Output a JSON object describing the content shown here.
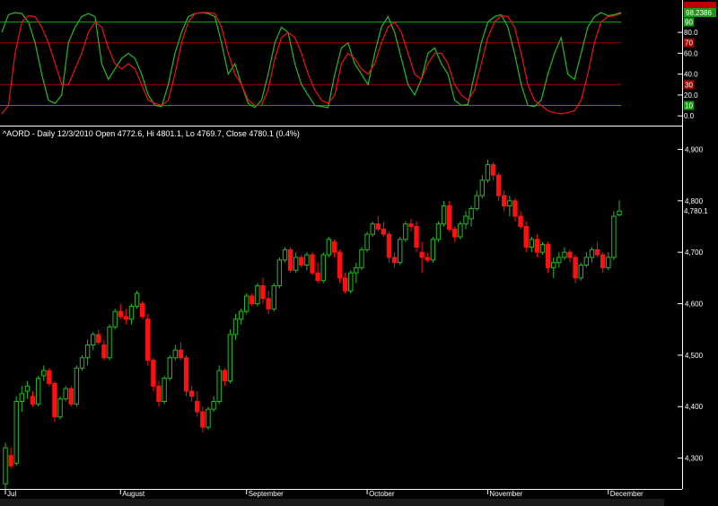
{
  "title": "^AORD - Daily 12/3/2010 Open 4772.6, Hi 4801.1, Lo 4769.7, Close 4780.1 (0.4%)",
  "colors": {
    "up": "#22bb22",
    "down": "#ff1010",
    "osc_green": "#22bb22",
    "osc_red": "#ee1111",
    "level90": "#139a13",
    "level70": "#a00000",
    "level30": "#a00000",
    "level10": "#139a13",
    "axis": "#ffffff",
    "bg": "#000000"
  },
  "chart_data": [
    {
      "type": "line",
      "name": "stochastic-oscillator",
      "ylim": [
        -5,
        105
      ],
      "y_ticks": [
        "20.0",
        "40.0",
        "60.0",
        "80.0",
        "0.0"
      ],
      "y_tick_values": [
        20,
        40,
        60,
        80,
        0
      ],
      "levels": [
        {
          "value": 90,
          "label": "90",
          "color": "#139a13"
        },
        {
          "value": 70,
          "label": "70",
          "color": "#a00000"
        },
        {
          "value": 30,
          "label": "30",
          "color": "#a00000"
        },
        {
          "value": 10,
          "label": "10",
          "color": "#139a13"
        }
      ],
      "last_value_label": "98.2386",
      "series": [
        {
          "color": "#22bb22",
          "values": [
            80,
            97,
            99,
            98,
            90,
            70,
            40,
            15,
            12,
            20,
            70,
            85,
            95,
            98,
            95,
            50,
            35,
            45,
            55,
            60,
            55,
            40,
            20,
            10,
            9,
            30,
            60,
            80,
            95,
            98,
            99,
            98,
            95,
            70,
            40,
            50,
            30,
            12,
            8,
            15,
            40,
            70,
            85,
            80,
            50,
            30,
            20,
            10,
            9,
            8,
            40,
            65,
            70,
            50,
            40,
            30,
            60,
            85,
            95,
            80,
            55,
            30,
            20,
            35,
            60,
            65,
            50,
            40,
            15,
            10,
            11,
            40,
            70,
            90,
            95,
            97,
            85,
            60,
            30,
            10,
            9,
            15,
            40,
            60,
            75,
            40,
            35,
            60,
            85,
            95,
            99,
            96,
            97,
            99
          ]
        },
        {
          "color": "#ee1111",
          "values": [
            2,
            10,
            60,
            90,
            96,
            95,
            85,
            70,
            50,
            30,
            30,
            45,
            60,
            80,
            90,
            85,
            65,
            50,
            45,
            50,
            45,
            30,
            15,
            12,
            10,
            15,
            40,
            70,
            90,
            98,
            99,
            99,
            98,
            85,
            60,
            40,
            30,
            15,
            10,
            10,
            25,
            55,
            75,
            80,
            75,
            60,
            40,
            25,
            15,
            12,
            20,
            50,
            60,
            55,
            45,
            40,
            50,
            70,
            85,
            90,
            80,
            60,
            40,
            35,
            50,
            60,
            60,
            50,
            30,
            20,
            15,
            25,
            50,
            75,
            90,
            96,
            95,
            85,
            60,
            30,
            15,
            10,
            5,
            3,
            2,
            3,
            5,
            15,
            40,
            70,
            90,
            95,
            96,
            98
          ]
        }
      ]
    },
    {
      "type": "candlestick",
      "name": "price",
      "ylim": [
        4240,
        4920
      ],
      "y_ticks": [
        "4,300",
        "4,400",
        "4,500",
        "4,600",
        "4,700",
        "4,800",
        "4,900"
      ],
      "y_tick_values": [
        4300,
        4400,
        4500,
        4600,
        4700,
        4800,
        4900
      ],
      "last_close_label": "4,780.1",
      "last_close_value": 4780.1,
      "x_labels": [
        "Jul",
        "August",
        "September",
        "October",
        "November",
        "December"
      ],
      "x_label_index": [
        0,
        21,
        44,
        66,
        88,
        110
      ],
      "ohlc": [
        [
          4250,
          4330,
          4240,
          4320
        ],
        [
          4305,
          4320,
          4280,
          4285
        ],
        [
          4290,
          4420,
          4285,
          4410
        ],
        [
          4410,
          4440,
          4390,
          4425
        ],
        [
          4430,
          4450,
          4415,
          4440
        ],
        [
          4420,
          4430,
          4400,
          4405
        ],
        [
          4405,
          4460,
          4400,
          4455
        ],
        [
          4460,
          4480,
          4450,
          4470
        ],
        [
          4470,
          4475,
          4440,
          4445
        ],
        [
          4445,
          4450,
          4370,
          4380
        ],
        [
          4380,
          4420,
          4375,
          4415
        ],
        [
          4415,
          4440,
          4410,
          4435
        ],
        [
          4435,
          4440,
          4400,
          4405
        ],
        [
          4405,
          4480,
          4400,
          4475
        ],
        [
          4475,
          4500,
          4470,
          4495
        ],
        [
          4495,
          4530,
          4480,
          4520
        ],
        [
          4520,
          4545,
          4510,
          4540
        ],
        [
          4540,
          4550,
          4520,
          4525
        ],
        [
          4520,
          4530,
          4490,
          4495
        ],
        [
          4495,
          4560,
          4490,
          4555
        ],
        [
          4555,
          4590,
          4550,
          4585
        ],
        [
          4585,
          4600,
          4570,
          4575
        ],
        [
          4575,
          4590,
          4560,
          4570
        ],
        [
          4570,
          4600,
          4560,
          4595
        ],
        [
          4595,
          4625,
          4590,
          4620
        ],
        [
          4600,
          4605,
          4570,
          4575
        ],
        [
          4570,
          4580,
          4480,
          4490
        ],
        [
          4490,
          4495,
          4430,
          4440
        ],
        [
          4440,
          4450,
          4400,
          4410
        ],
        [
          4410,
          4460,
          4405,
          4455
        ],
        [
          4455,
          4500,
          4450,
          4495
        ],
        [
          4495,
          4520,
          4490,
          4510
        ],
        [
          4510,
          4525,
          4490,
          4495
        ],
        [
          4495,
          4500,
          4420,
          4430
        ],
        [
          4430,
          4440,
          4410,
          4420
        ],
        [
          4410,
          4430,
          4380,
          4390
        ],
        [
          4390,
          4400,
          4350,
          4360
        ],
        [
          4360,
          4400,
          4355,
          4395
        ],
        [
          4395,
          4420,
          4390,
          4410
        ],
        [
          4410,
          4480,
          4405,
          4470
        ],
        [
          4470,
          4475,
          4440,
          4450
        ],
        [
          4450,
          4550,
          4445,
          4540
        ],
        [
          4540,
          4580,
          4530,
          4570
        ],
        [
          4570,
          4590,
          4560,
          4585
        ],
        [
          4585,
          4620,
          4580,
          4615
        ],
        [
          4615,
          4620,
          4595,
          4600
        ],
        [
          4600,
          4640,
          4595,
          4635
        ],
        [
          4635,
          4650,
          4600,
          4610
        ],
        [
          4610,
          4625,
          4580,
          4590
        ],
        [
          4590,
          4640,
          4585,
          4635
        ],
        [
          4635,
          4690,
          4630,
          4685
        ],
        [
          4685,
          4710,
          4680,
          4705
        ],
        [
          4705,
          4710,
          4660,
          4665
        ],
        [
          4665,
          4700,
          4660,
          4690
        ],
        [
          4690,
          4695,
          4670,
          4675
        ],
        [
          4675,
          4700,
          4665,
          4695
        ],
        [
          4695,
          4700,
          4655,
          4660
        ],
        [
          4660,
          4680,
          4640,
          4645
        ],
        [
          4645,
          4700,
          4640,
          4695
        ],
        [
          4695,
          4730,
          4690,
          4725
        ],
        [
          4720,
          4725,
          4690,
          4700
        ],
        [
          4700,
          4705,
          4640,
          4650
        ],
        [
          4650,
          4660,
          4620,
          4625
        ],
        [
          4625,
          4665,
          4620,
          4660
        ],
        [
          4660,
          4680,
          4640,
          4670
        ],
        [
          4670,
          4710,
          4665,
          4705
        ],
        [
          4705,
          4740,
          4700,
          4735
        ],
        [
          4735,
          4760,
          4730,
          4755
        ],
        [
          4755,
          4770,
          4740,
          4745
        ],
        [
          4745,
          4760,
          4730,
          4735
        ],
        [
          4735,
          4740,
          4680,
          4690
        ],
        [
          4690,
          4700,
          4670,
          4680
        ],
        [
          4680,
          4730,
          4675,
          4725
        ],
        [
          4725,
          4760,
          4720,
          4755
        ],
        [
          4755,
          4765,
          4740,
          4750
        ],
        [
          4750,
          4760,
          4700,
          4710
        ],
        [
          4700,
          4720,
          4660,
          4690
        ],
        [
          4690,
          4700,
          4680,
          4685
        ],
        [
          4685,
          4730,
          4680,
          4725
        ],
        [
          4725,
          4760,
          4720,
          4755
        ],
        [
          4755,
          4800,
          4750,
          4790
        ],
        [
          4790,
          4800,
          4740,
          4745
        ],
        [
          4745,
          4750,
          4720,
          4730
        ],
        [
          4730,
          4760,
          4725,
          4755
        ],
        [
          4755,
          4780,
          4745,
          4770
        ],
        [
          4765,
          4790,
          4750,
          4785
        ],
        [
          4785,
          4820,
          4780,
          4810
        ],
        [
          4810,
          4850,
          4805,
          4840
        ],
        [
          4840,
          4880,
          4835,
          4870
        ],
        [
          4870,
          4875,
          4840,
          4850
        ],
        [
          4850,
          4855,
          4800,
          4810
        ],
        [
          4810,
          4820,
          4780,
          4790
        ],
        [
          4790,
          4810,
          4770,
          4800
        ],
        [
          4800,
          4805,
          4760,
          4770
        ],
        [
          4770,
          4780,
          4745,
          4750
        ],
        [
          4750,
          4760,
          4700,
          4710
        ],
        [
          4710,
          4730,
          4700,
          4725
        ],
        [
          4725,
          4735,
          4690,
          4700
        ],
        [
          4700,
          4720,
          4695,
          4715
        ],
        [
          4715,
          4720,
          4660,
          4670
        ],
        [
          4670,
          4690,
          4650,
          4680
        ],
        [
          4680,
          4700,
          4670,
          4690
        ],
        [
          4690,
          4710,
          4685,
          4700
        ],
        [
          4700,
          4705,
          4680,
          4690
        ],
        [
          4690,
          4695,
          4640,
          4650
        ],
        [
          4650,
          4680,
          4645,
          4675
        ],
        [
          4675,
          4700,
          4670,
          4690
        ],
        [
          4690,
          4710,
          4680,
          4705
        ],
        [
          4705,
          4720,
          4690,
          4695
        ],
        [
          4695,
          4700,
          4660,
          4670
        ],
        [
          4670,
          4700,
          4665,
          4690
        ],
        [
          4690,
          4780,
          4685,
          4770
        ],
        [
          4772.6,
          4801.1,
          4769.7,
          4780.1
        ]
      ]
    }
  ]
}
